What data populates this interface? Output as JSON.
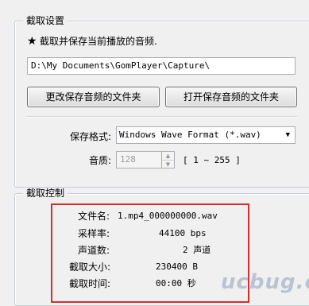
{
  "capture_settings": {
    "title": "截取设置",
    "option_label": "截取并保存当前播放的音频.",
    "path_value": "D:\\My Documents\\GomPlayer\\Capture\\",
    "change_folder_label": "更改保存音频的文件夹",
    "open_folder_label": "打开保存音频的文件夹",
    "format_label": "保存格式:",
    "format_value": "Windows Wave Format (*.wav)",
    "quality_label": "音质:",
    "quality_value": "128",
    "quality_range": "[ 1 ~ 255 ]"
  },
  "capture_control": {
    "title": "截取控制",
    "rows": [
      {
        "label": "文件名:",
        "value": "1.mp4_000000000.wav"
      },
      {
        "label": "采样率:",
        "value": "44100 bps"
      },
      {
        "label": "声道数:",
        "value": "2 声道"
      },
      {
        "label": "截取大小:",
        "value": "230400 B"
      },
      {
        "label": "截取时间:",
        "value": "00:00 秒"
      }
    ]
  },
  "watermark": "ucbug.com",
  "colors": {
    "highlight_border": "#d62d2d",
    "group_border": "#c6cdd6"
  }
}
